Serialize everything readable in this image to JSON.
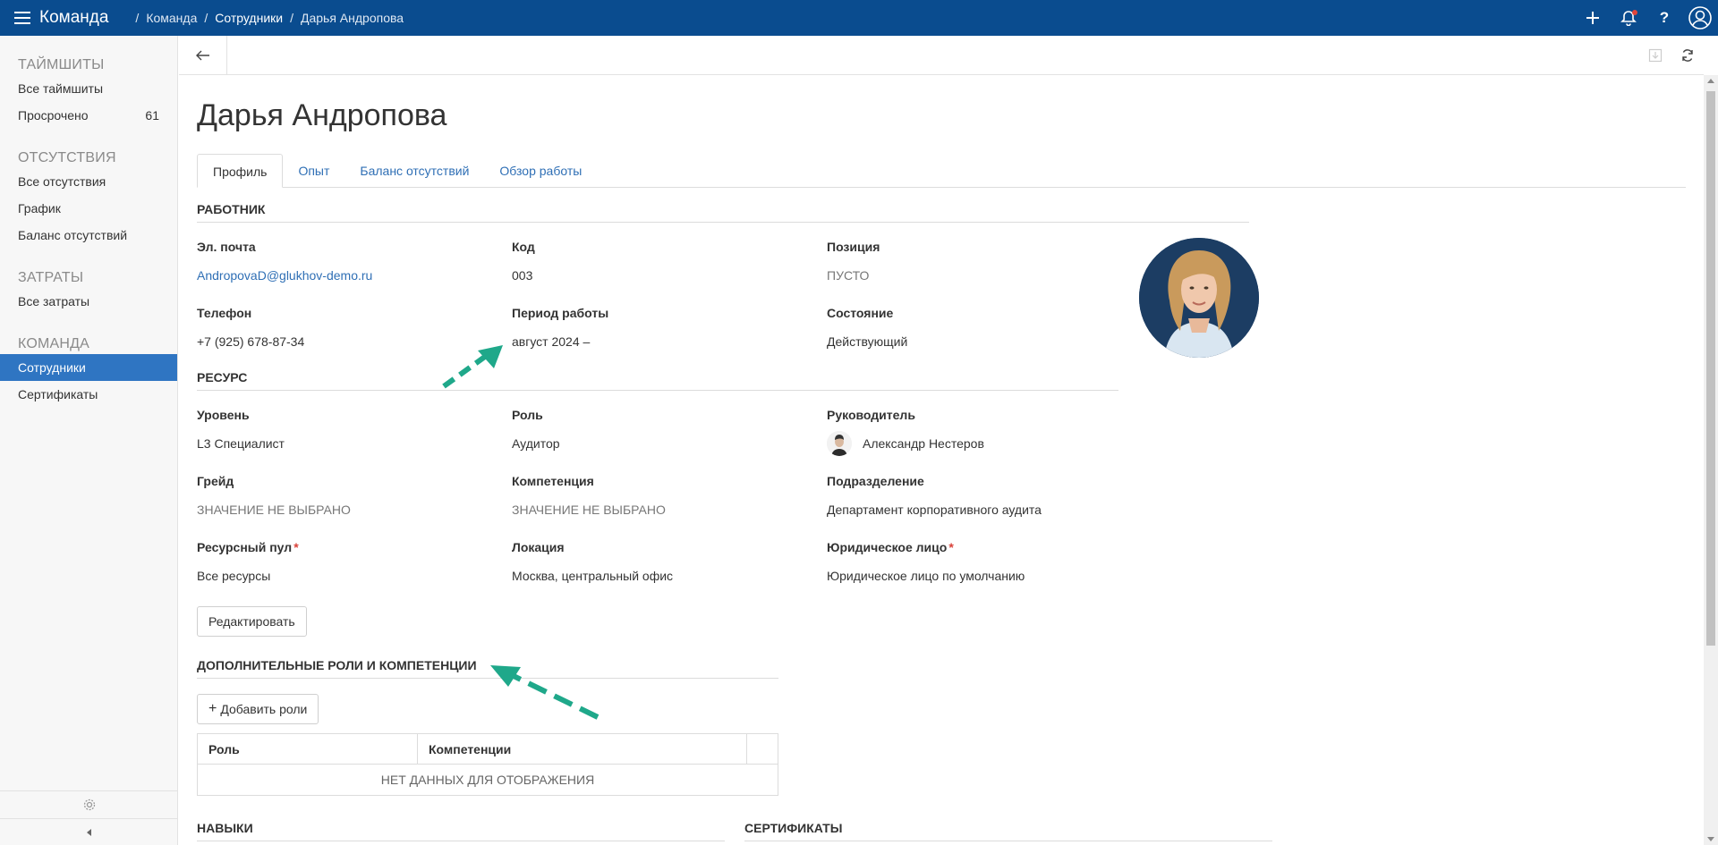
{
  "topbar": {
    "app_title": "Команда",
    "breadcrumb": [
      "Команда",
      "Сотрудники",
      "Дарья Андропова"
    ]
  },
  "sidebar": {
    "sections": [
      {
        "title": "ТАЙМШИТЫ",
        "items": [
          {
            "label": "Все таймшиты"
          },
          {
            "label": "Просрочено",
            "count": "61"
          }
        ]
      },
      {
        "title": "ОТСУТСТВИЯ",
        "items": [
          {
            "label": "Все отсутствия"
          },
          {
            "label": "График"
          },
          {
            "label": "Баланс отсутствий"
          }
        ]
      },
      {
        "title": "ЗАТРАТЫ",
        "items": [
          {
            "label": "Все затраты"
          }
        ]
      },
      {
        "title": "КОМАНДА",
        "items": [
          {
            "label": "Сотрудники",
            "active": true
          },
          {
            "label": "Сертификаты"
          }
        ]
      }
    ]
  },
  "page": {
    "title": "Дарья Андропова",
    "tabs": [
      "Профиль",
      "Опыт",
      "Баланс отсутствий",
      "Обзор работы"
    ],
    "active_tab": "Профиль"
  },
  "worker": {
    "section_title": "РАБОТНИК",
    "email_label": "Эл. почта",
    "email": "AndropovaD@glukhov-demo.ru",
    "code_label": "Код",
    "code": "003",
    "position_label": "Позиция",
    "position": "ПУСТО",
    "phone_label": "Телефон",
    "phone": "+7 (925) 678-87-34",
    "period_label": "Период работы",
    "period": "август 2024 –",
    "state_label": "Состояние",
    "state": "Действующий"
  },
  "resource": {
    "section_title": "РЕСУРС",
    "level_label": "Уровень",
    "level": "L3 Специалист",
    "role_label": "Роль",
    "role": "Аудитор",
    "manager_label": "Руководитель",
    "manager": "Александр Нестеров",
    "grade_label": "Грейд",
    "grade": "ЗНАЧЕНИЕ НЕ ВЫБРАНО",
    "competence_label": "Компетенция",
    "competence": "ЗНАЧЕНИЕ НЕ ВЫБРАНО",
    "department_label": "Подразделение",
    "department": "Департамент корпоративного аудита",
    "pool_label": "Ресурсный пул",
    "pool": "Все ресурсы",
    "location_label": "Локация",
    "location": "Москва, центральный офис",
    "legal_label": "Юридическое лицо",
    "legal": "Юридическое лицо по умолчанию",
    "required_mark": "*",
    "edit_button": "Редактировать"
  },
  "additional": {
    "section_title": "ДОПОЛНИТЕЛЬНЫЕ РОЛИ И КОМПЕТЕНЦИИ",
    "add_button": "Добавить роли",
    "columns": [
      "Роль",
      "Компетенции"
    ],
    "empty_text": "НЕТ ДАННЫХ ДЛЯ ОТОБРАЖЕНИЯ"
  },
  "bottom_sections": {
    "skills_title": "НАВЫКИ",
    "certs_title": "СЕРТИФИКАТЫ"
  },
  "colors": {
    "topbar": "#0a4c8f",
    "link": "#2f6fb5",
    "active_nav": "#2f75c2",
    "annotation_arrow": "#1fa88a"
  }
}
